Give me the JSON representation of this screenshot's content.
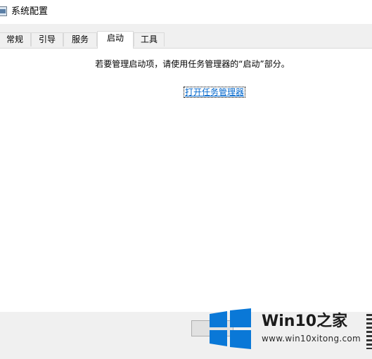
{
  "window": {
    "title": "系统配置",
    "icon": "msconfig-icon"
  },
  "tabs": [
    {
      "label": "常规",
      "active": false
    },
    {
      "label": "引导",
      "active": false
    },
    {
      "label": "服务",
      "active": false
    },
    {
      "label": "启动",
      "active": true
    },
    {
      "label": "工具",
      "active": false
    }
  ],
  "startup": {
    "message": "若要管理启动项，请使用任务管理器的“启动”部分。",
    "link_label": "打开任务管理器"
  },
  "watermark": {
    "brand_prefix": "Win10",
    "brand_suffix": "之家",
    "url": "www.win10xitong.com",
    "logo_color": "#0a78d7"
  },
  "colors": {
    "link": "#0066cc",
    "content_bg": "#ffffff",
    "chrome_bg": "#f0f0f0"
  }
}
